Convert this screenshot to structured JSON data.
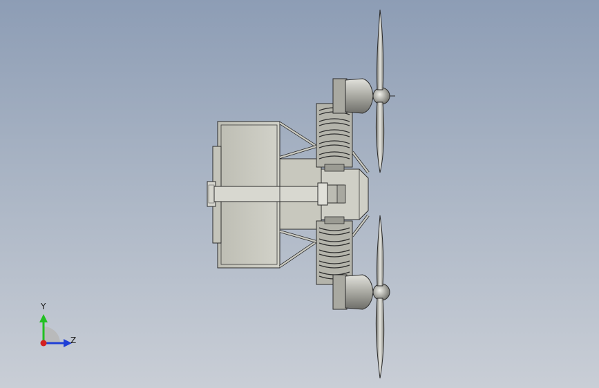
{
  "viewport": {
    "background_top": "#8d9db5",
    "background_bottom": "#c9ced6"
  },
  "model": {
    "body_color": "#c9c9bf",
    "line_color": "#2b2b2b",
    "metal_light": "#dcdcd6",
    "metal_dark": "#7d7d78"
  },
  "triad": {
    "y_label": "Y",
    "z_label": "Z",
    "y_color": "#22c022",
    "z_color": "#1f3fd6",
    "x_color": "#d42020",
    "plane_color": "#b8b8b8"
  }
}
